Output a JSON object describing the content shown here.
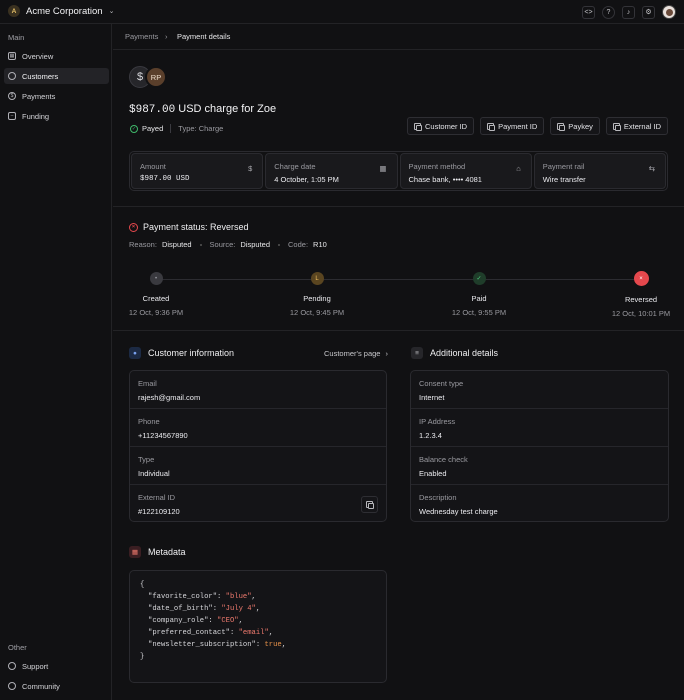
{
  "org": {
    "initial": "A",
    "name": "Acme Corporation"
  },
  "sidebar": {
    "main_heading": "Main",
    "items": [
      {
        "label": "Overview",
        "icon": "grid-icon"
      },
      {
        "label": "Customers",
        "icon": "users-icon",
        "active": true
      },
      {
        "label": "Payments",
        "icon": "dollar-circle-icon"
      },
      {
        "label": "Funding",
        "icon": "card-icon"
      }
    ],
    "other_heading": "Other",
    "other_items": [
      {
        "label": "Support",
        "icon": "support-icon"
      },
      {
        "label": "Community",
        "icon": "globe-icon"
      }
    ]
  },
  "breadcrumb": {
    "parent": "Payments",
    "current": "Payment details"
  },
  "avatars": {
    "primary_glyph": "$",
    "secondary_initials": "RP"
  },
  "payment": {
    "amount": "$987.00",
    "title_rest": "USD charge for Zoe",
    "status": "Payed",
    "type": "Type: Charge"
  },
  "id_buttons": [
    "Customer ID",
    "Payment ID",
    "Paykey",
    "External ID"
  ],
  "stats": [
    {
      "label": "Amount",
      "value": "$987.00 USD",
      "icon": "$",
      "mono": true
    },
    {
      "label": "Charge date",
      "value": "4 October, 1:05 PM",
      "icon": "▦"
    },
    {
      "label": "Payment method",
      "value": "Chase bank, •••• 4081",
      "icon": "⌂"
    },
    {
      "label": "Payment rail",
      "value": "Wire transfer",
      "icon": "⇆"
    }
  ],
  "payment_status": {
    "title": "Payment status: Reversed",
    "reason_label": "Reason:",
    "reason": "Disputed",
    "source_label": "Source:",
    "source": "Disputed",
    "code_label": "Code:",
    "code": "R10"
  },
  "timeline": [
    {
      "name": "Created",
      "time": "12 Oct, 9:36 PM",
      "color": "#3a3a3f",
      "glyph": "•"
    },
    {
      "name": "Pending",
      "time": "12 Oct, 9:45 PM",
      "color": "#5a4520",
      "glyph": "L"
    },
    {
      "name": "Paid",
      "time": "12 Oct, 9:55 PM",
      "color": "#1f3d2a",
      "glyph": "✓"
    },
    {
      "name": "Reversed",
      "time": "12 Oct, 10:01 PM",
      "color": "#e5484d",
      "glyph": "×"
    }
  ],
  "customer": {
    "title": "Customer information",
    "link": "Customer's page",
    "rows": [
      {
        "label": "Email",
        "value": "rajesh@gmail.com"
      },
      {
        "label": "Phone",
        "value": "+11234567890"
      },
      {
        "label": "Type",
        "value": "Individual"
      },
      {
        "label": "External ID",
        "value": "#122109120"
      }
    ]
  },
  "additional": {
    "title": "Additional details",
    "rows": [
      {
        "label": "Consent type",
        "value": "Internet"
      },
      {
        "label": "IP Address",
        "value": "1.2.3.4"
      },
      {
        "label": "Balance check",
        "value": "Enabled"
      },
      {
        "label": "Description",
        "value": "Wednesday test charge"
      }
    ]
  },
  "metadata": {
    "title": "Metadata",
    "open": "{",
    "close": "}",
    "entries": [
      {
        "key": "\"favorite_color\"",
        "value": "\"blue\"",
        "kind": "s"
      },
      {
        "key": "\"date_of_birth\"",
        "value": "\"July 4\"",
        "kind": "s"
      },
      {
        "key": "\"company_role\"",
        "value": "\"CEO\"",
        "kind": "s"
      },
      {
        "key": "\"preferred_contact\"",
        "value": "\"email\"",
        "kind": "s"
      },
      {
        "key": "\"newsletter_subscription\"",
        "value": "true",
        "kind": "b"
      }
    ]
  }
}
